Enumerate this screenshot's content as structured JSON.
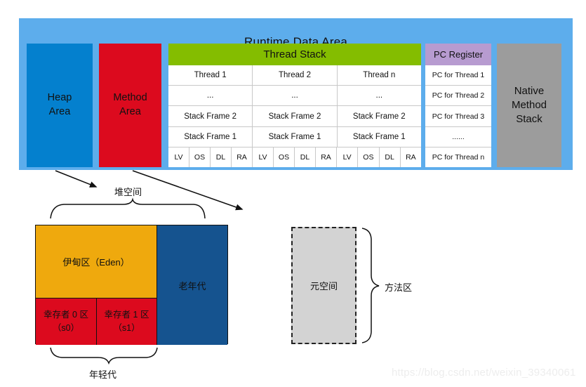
{
  "runtime_data_area": {
    "title": "Runtime Data Area",
    "panel_color": "#5DADEC",
    "heap_area": {
      "label": "Heap\nArea",
      "line1": "Heap",
      "line2": "Area",
      "color": "#0480CE"
    },
    "method_area": {
      "label": "Method\nArea",
      "line1": "Method",
      "line2": "Area",
      "color": "#DC0A1E"
    },
    "native_method_stack": {
      "line1": "Native",
      "line2": "Method",
      "line3": "Stack",
      "color": "#9C9C9C"
    },
    "thread_stack": {
      "header": "Thread Stack",
      "header_color": "#84BD00",
      "columns": [
        "Thread 1",
        "Thread 2",
        "Thread n"
      ],
      "rows": [
        [
          "...",
          "...",
          "..."
        ],
        [
          "Stack Frame 2",
          "Stack Frame 2",
          "Stack Frame 2"
        ],
        [
          "Stack Frame 1",
          "Stack Frame 1",
          "Stack Frame 1"
        ]
      ],
      "frame_parts": [
        "LV",
        "OS",
        "DL",
        "RA"
      ]
    },
    "pc_register": {
      "header": "PC Register",
      "header_color": "#B79BD0",
      "entries": [
        "PC for Thread 1",
        "PC for Thread 2",
        "PC for Thread 3",
        "......",
        "PC for Thread n"
      ]
    }
  },
  "heap_detail": {
    "eden": "伊甸区（Eden）",
    "eden_color": "#EFA90D",
    "survivor0_line1": "幸存者 0 区",
    "survivor0_line2": "（s0）",
    "survivor1_line1": "幸存者 1 区",
    "survivor1_line2": "（s1）",
    "survivor_color": "#DC0A1E",
    "old_generation": "老年代",
    "old_generation_color": "#15538F",
    "brace_top_label": "堆空间",
    "brace_bottom_label": "年轻代"
  },
  "method_area_detail": {
    "metaspace": "元空间",
    "metaspace_color": "#D3D3D3",
    "brace_label": "方法区"
  },
  "watermark": "https://blog.csdn.net/weixin_39340061"
}
